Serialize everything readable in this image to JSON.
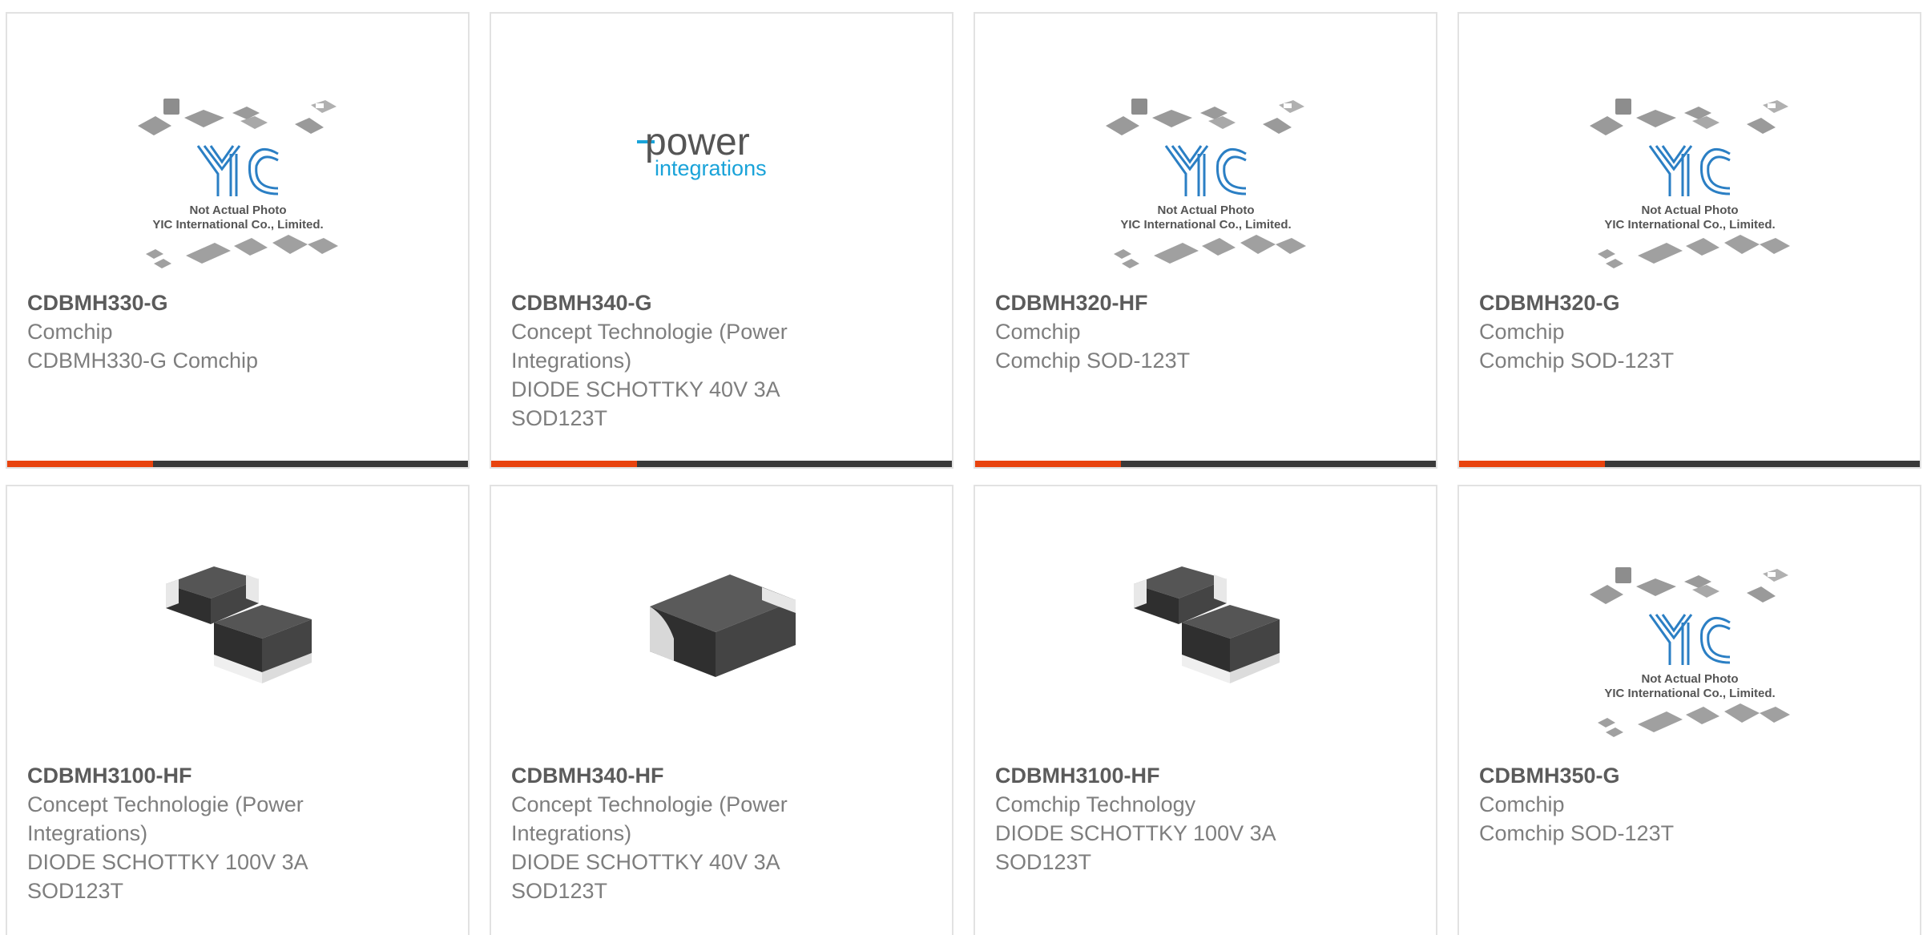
{
  "products": [
    {
      "part_number": "CDBMH330-G",
      "manufacturer": "Comchip",
      "description": "CDBMH330-G Comchip",
      "image": "yic-placeholder"
    },
    {
      "part_number": "CDBMH340-G",
      "manufacturer": "Concept Technologie (Power Integrations)",
      "description": "DIODE SCHOTTKY 40V 3A SOD123T",
      "image": "power-integrations-logo"
    },
    {
      "part_number": "CDBMH320-HF",
      "manufacturer": "Comchip",
      "description": "Comchip SOD-123T",
      "image": "yic-placeholder"
    },
    {
      "part_number": "CDBMH320-G",
      "manufacturer": "Comchip",
      "description": "Comchip SOD-123T",
      "image": "yic-placeholder"
    },
    {
      "part_number": "CDBMH3100-HF",
      "manufacturer": "Concept Technologie (Power Integrations)",
      "description": "DIODE SCHOTTKY 100V 3A SOD123T",
      "image": "smd-diode-pair"
    },
    {
      "part_number": "CDBMH340-HF",
      "manufacturer": "Concept Technologie (Power Integrations)",
      "description": "DIODE SCHOTTKY 40V 3A SOD123T",
      "image": "smd-diode-single"
    },
    {
      "part_number": "CDBMH3100-HF",
      "manufacturer": "Comchip Technology",
      "description": "DIODE SCHOTTKY 100V 3A SOD123T",
      "image": "smd-diode-pair"
    },
    {
      "part_number": "CDBMH350-G",
      "manufacturer": "Comchip",
      "description": "Comchip SOD-123T",
      "image": "yic-placeholder"
    }
  ],
  "placeholder": {
    "brand": "YIC",
    "line1": "Not Actual Photo",
    "line2": "YIC International Co., Limited."
  },
  "power_logo": {
    "word1": "power",
    "word2": "integrations"
  },
  "colors": {
    "accent": "#e8430e",
    "bar": "#3a3a3a",
    "border": "#e2e2e2",
    "yic_blue": "#2b7fc4",
    "power_blue": "#1aa3d9"
  }
}
